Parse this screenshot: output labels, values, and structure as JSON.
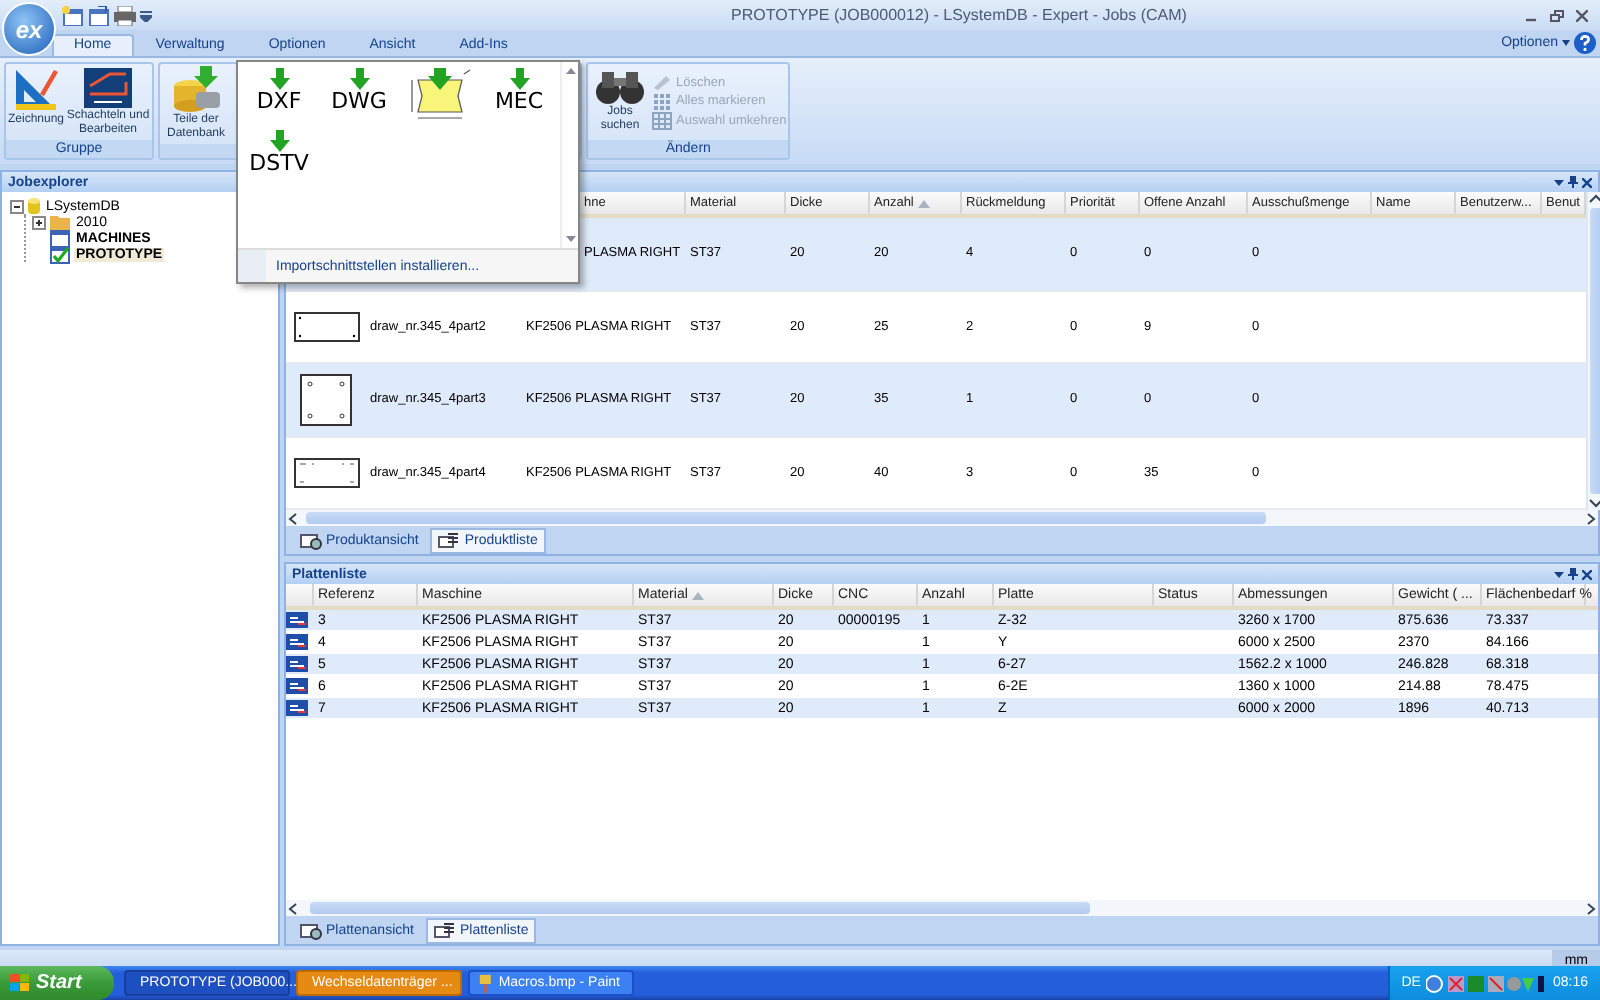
{
  "window": {
    "title": "PROTOTYPE (JOB000012) - LSystemDB - Expert - Jobs (CAM)",
    "logo_text": "ex"
  },
  "ribbon_tabs": [
    {
      "label": "Home",
      "selected": true
    },
    {
      "label": "Verwaltung",
      "selected": false
    },
    {
      "label": "Optionen",
      "selected": false
    },
    {
      "label": "Ansicht",
      "selected": false
    },
    {
      "label": "Add-Ins",
      "selected": false
    }
  ],
  "options_menu": "Optionen",
  "ribbon_groups": [
    {
      "label": "Gruppe",
      "buttons": [
        {
          "label": "Zeichnung",
          "kind": "drawing"
        },
        {
          "label": "Schachteln und Bearbeiten",
          "kind": "nesting"
        }
      ]
    },
    {
      "buttons": [
        {
          "label": "Teile der Datenbank",
          "kind": "database"
        }
      ]
    },
    {
      "label": "Ändern",
      "buttons": [
        {
          "label": "Jobs suchen",
          "kind": "binoculars"
        }
      ],
      "small_buttons": [
        {
          "label": "Löschen",
          "kind": "eraser",
          "disabled": true
        },
        {
          "label": "Alles markieren",
          "kind": "dots",
          "disabled": true
        },
        {
          "label": "Auswahl umkehren",
          "kind": "grid",
          "disabled": true
        }
      ]
    }
  ],
  "import_gallery": {
    "items": [
      {
        "kind": "format",
        "label": "DXF"
      },
      {
        "kind": "format",
        "label": "DWG"
      },
      {
        "kind": "shape"
      },
      {
        "kind": "format",
        "label": "MEC"
      },
      {
        "kind": "format",
        "label": "DSTV"
      }
    ],
    "footer": "Importschnittstellen installieren..."
  },
  "jobexplorer": {
    "title": "Jobexplorer",
    "tree": [
      {
        "label": "LSystemDB",
        "kind": "database",
        "expanded": true,
        "selected": false,
        "children": [
          {
            "label": "2010",
            "kind": "folder",
            "expanded": false,
            "selected": false
          },
          {
            "label": "MACHINES",
            "kind": "job",
            "checked": false,
            "selected": false
          },
          {
            "label": "PROTOTYPE",
            "kind": "job",
            "checked": true,
            "selected": true
          }
        ]
      }
    ]
  },
  "product_list": {
    "columns": [
      {
        "label": "hne",
        "sorted": false
      },
      {
        "label": "Material",
        "sorted": false
      },
      {
        "label": "Dicke",
        "sorted": false
      },
      {
        "label": "Anzahl",
        "sorted": true
      },
      {
        "label": "Rückmeldung",
        "sorted": false
      },
      {
        "label": "Priorität",
        "sorted": false
      },
      {
        "label": "Offene Anzahl",
        "sorted": false
      },
      {
        "label": "Ausschußmenge",
        "sorted": false
      },
      {
        "label": "Name",
        "sorted": false
      },
      {
        "label": "Benutzerw...",
        "sorted": false
      },
      {
        "label": "Benut",
        "sorted": false
      }
    ],
    "rows": [
      {
        "cells": [
          "PLASMA RIGHT",
          "ST37",
          "20",
          "20",
          "4",
          "0",
          "0",
          "0"
        ]
      },
      {
        "thumbnail": {
          "kind": "wide"
        },
        "name": "draw_nr.345_4part2",
        "cells": [
          "KF2506 PLASMA RIGHT",
          "ST37",
          "20",
          "25",
          "2",
          "0",
          "9",
          "0"
        ]
      },
      {
        "thumbnail": {
          "kind": "square"
        },
        "name": "draw_nr.345_4part3",
        "cells": [
          "KF2506 PLASMA RIGHT",
          "ST37",
          "20",
          "35",
          "1",
          "0",
          "0",
          "0"
        ]
      },
      {
        "thumbnail": {
          "kind": "wide_marked"
        },
        "name": "draw_nr.345_4part4",
        "cells": [
          "KF2506 PLASMA RIGHT",
          "ST37",
          "20",
          "40",
          "3",
          "0",
          "35",
          "0"
        ]
      }
    ],
    "tabs": [
      {
        "label": "Produktansicht",
        "selected": false
      },
      {
        "label": "Produktliste",
        "selected": true
      }
    ]
  },
  "plate_list": {
    "title": "Plattenliste",
    "columns": [
      {
        "label": "Referenz",
        "sorted": false
      },
      {
        "label": "Maschine",
        "sorted": false
      },
      {
        "label": "Material",
        "sorted": true
      },
      {
        "label": "Dicke",
        "sorted": false
      },
      {
        "label": "CNC",
        "sorted": false
      },
      {
        "label": "Anzahl",
        "sorted": false
      },
      {
        "label": "Platte",
        "sorted": false
      },
      {
        "label": "Status",
        "sorted": false
      },
      {
        "label": "Abmessungen",
        "sorted": false
      },
      {
        "label": "Gewicht ( ...",
        "sorted": false
      },
      {
        "label": "Flächenbedarf %",
        "sorted": false
      }
    ],
    "rows": [
      [
        "3",
        "KF2506 PLASMA RIGHT",
        "ST37",
        "20",
        "00000195",
        "1",
        "Z-32",
        "",
        "3260 x 1700",
        "875.636",
        "73.337"
      ],
      [
        "4",
        "KF2506 PLASMA RIGHT",
        "ST37",
        "20",
        "",
        "1",
        "Y",
        "",
        "6000 x 2500",
        "2370",
        "84.166"
      ],
      [
        "5",
        "KF2506 PLASMA RIGHT",
        "ST37",
        "20",
        "",
        "1",
        "6-27",
        "",
        "1562.2 x 1000",
        "246.828",
        "68.318"
      ],
      [
        "6",
        "KF2506 PLASMA RIGHT",
        "ST37",
        "20",
        "",
        "1",
        "6-2E",
        "",
        "1360 x 1000",
        "214.88",
        "78.475"
      ],
      [
        "7",
        "KF2506 PLASMA RIGHT",
        "ST37",
        "20",
        "",
        "1",
        "Z",
        "",
        "6000 x 2000",
        "1896",
        "40.713"
      ]
    ],
    "tabs": [
      {
        "label": "Plattenansicht",
        "selected": false
      },
      {
        "label": "Plattenliste",
        "selected": true
      }
    ]
  },
  "status_bar": {
    "unit": "mm"
  },
  "taskbar": {
    "start": "Start",
    "tasks": [
      {
        "label": "PROTOTYPE (JOB000...",
        "kind": "app",
        "highlighted": false
      },
      {
        "label": "Wechseldatenträger ...",
        "kind": "folder",
        "highlighted": true
      },
      {
        "label": "Macros.bmp - Paint",
        "kind": "paint",
        "highlighted": false
      }
    ],
    "language": "DE",
    "clock": "08:16"
  }
}
